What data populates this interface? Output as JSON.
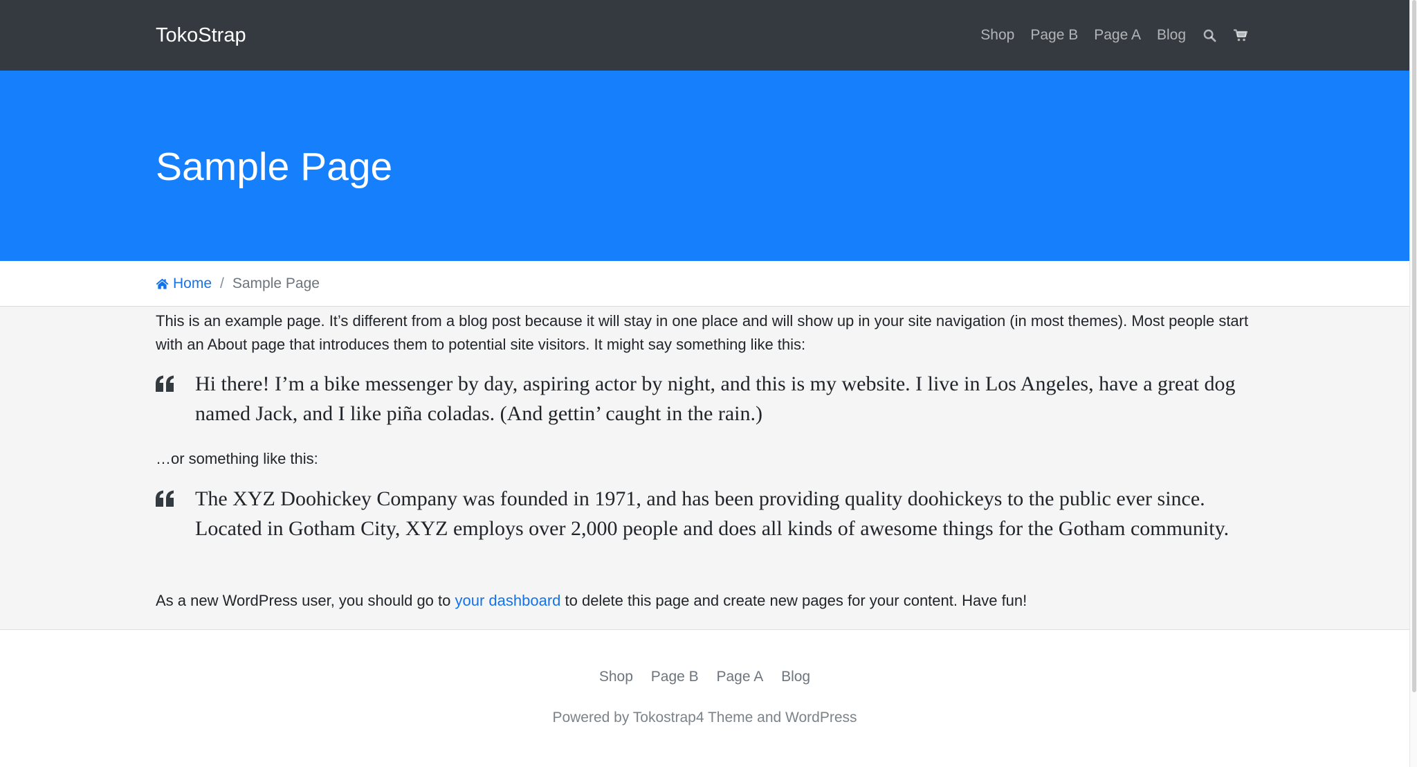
{
  "navbar": {
    "brand": "TokoStrap",
    "links": [
      "Shop",
      "Page B",
      "Page A",
      "Blog"
    ],
    "icons": [
      "search-icon",
      "cart-icon"
    ]
  },
  "hero": {
    "title": "Sample Page"
  },
  "breadcrumb": {
    "home": "Home",
    "separator": "/",
    "current": "Sample Page"
  },
  "content": {
    "intro": "This is an example page. It’s different from a blog post because it will stay in one place and will show up in your site navigation (in most themes). Most people start with an About page that introduces them to potential site visitors. It might say something like this:",
    "quote1": "Hi there! I’m a bike messenger by day, aspiring actor by night, and this is my website. I live in Los Angeles, have a great dog named Jack, and I like piña coladas. (And gettin’ caught in the rain.)",
    "or_text": "…or something like this:",
    "quote2": "The XYZ Doohickey Company was founded in 1971, and has been providing quality doohickeys to the public ever since. Located in Gotham City, XYZ employs over 2,000 people and does all kinds of awesome things for the Gotham community.",
    "outro_before": "As a new WordPress user, you should go to ",
    "outro_link": "your dashboard",
    "outro_after": " to delete this page and create new pages for your content. Have fun!"
  },
  "footer": {
    "links": [
      "Shop",
      "Page B",
      "Page A",
      "Blog"
    ],
    "credit": "Powered by Tokostrap4 Theme and WordPress"
  },
  "colors": {
    "navbar_bg": "#343a40",
    "hero_bg": "#167ffc",
    "link": "#1572e8",
    "content_bg": "#f5f5f5"
  }
}
